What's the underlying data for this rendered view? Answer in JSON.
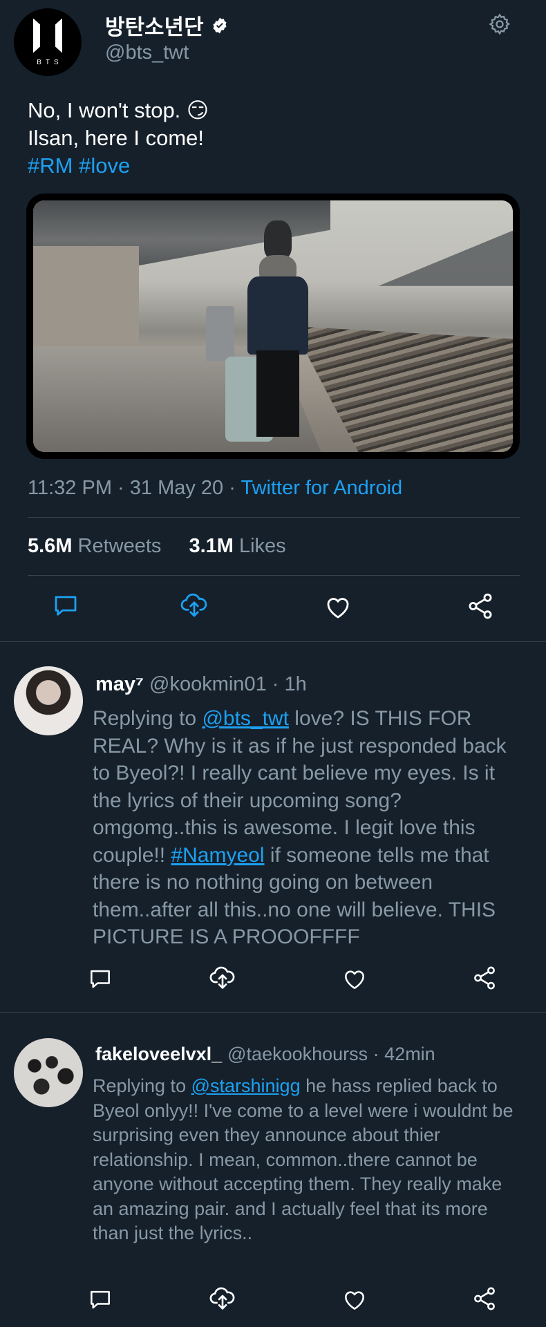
{
  "tweet": {
    "avatar_text": "BTS",
    "display_name": "방탄소년단",
    "handle": "@bts_twt",
    "text_line1": "No, I won't stop. 😏",
    "text_line2": "Ilsan, here I come!",
    "hashtag1": "#RM",
    "hashtag2": "#love",
    "time": "11:32 PM",
    "date": "31 May 20",
    "source": "Twitter for Android",
    "retweets_count": "5.6M",
    "retweets_label": "Retweets",
    "likes_count": "3.1M",
    "likes_label": "Likes"
  },
  "replies": [
    {
      "name": "may⁷",
      "handle": "@kookmin01",
      "time": "1h",
      "replying_prefix": "Replying to",
      "mention": "@bts_twt",
      "text_part1": "love? IS THIS FOR REAL? Why is it as if he just responded back to Byeol?! I really cant believe my eyes. Is it the lyrics of their upcoming song? omgomg..this is awesome.  I legit love this couple!!",
      "hashtag": "#Namyeol",
      "text_part2": "if someone tells me that there is no nothing going on between them..after all this..no one will believe.  THIS PICTURE IS A PROOOFFFF"
    },
    {
      "name": "fakeloveelvxl_",
      "handle": "@taekookhourss",
      "time": "42min",
      "replying_prefix": "Replying to",
      "mention": "@starshinigg",
      "text_part1": "he hass replied back to Byeol onlyy!! I've come to a level were i wouldnt be surprising even they announce about thier relationship. I mean, common..there cannot be anyone without accepting them. They really make an amazing pair. and I actually feel that its more than just the lyrics.."
    }
  ],
  "icons": {
    "reply": "reply-icon",
    "retweet": "retweet-icon",
    "like": "like-icon",
    "share": "share-icon",
    "settings": "gear-icon",
    "verified": "verified-badge-icon"
  },
  "colors": {
    "background": "#15202b",
    "accent": "#1da1f2",
    "secondary_text": "#8899a6",
    "divider": "#38444d"
  }
}
